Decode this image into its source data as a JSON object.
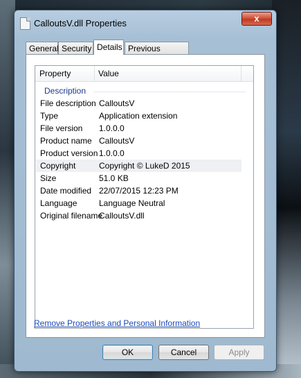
{
  "window": {
    "title": "CalloutsV.dll Properties",
    "close_label": "x"
  },
  "tabs": [
    {
      "label": "General"
    },
    {
      "label": "Security"
    },
    {
      "label": "Details"
    },
    {
      "label": "Previous Versions"
    }
  ],
  "details": {
    "columns": {
      "property": "Property",
      "value": "Value"
    },
    "group": "Description",
    "rows": [
      {
        "property": "File description",
        "value": "CalloutsV"
      },
      {
        "property": "Type",
        "value": "Application extension"
      },
      {
        "property": "File version",
        "value": "1.0.0.0"
      },
      {
        "property": "Product name",
        "value": "CalloutsV"
      },
      {
        "property": "Product version",
        "value": "1.0.0.0"
      },
      {
        "property": "Copyright",
        "value": "Copyright © LukeD 2015"
      },
      {
        "property": "Size",
        "value": "51.0 KB"
      },
      {
        "property": "Date modified",
        "value": "22/07/2015 12:23 PM"
      },
      {
        "property": "Language",
        "value": "Language Neutral"
      },
      {
        "property": "Original filename",
        "value": "CalloutsV.dll"
      }
    ]
  },
  "remove_link": "Remove Properties and Personal Information",
  "buttons": {
    "ok": "OK",
    "cancel": "Cancel",
    "apply": "Apply"
  }
}
